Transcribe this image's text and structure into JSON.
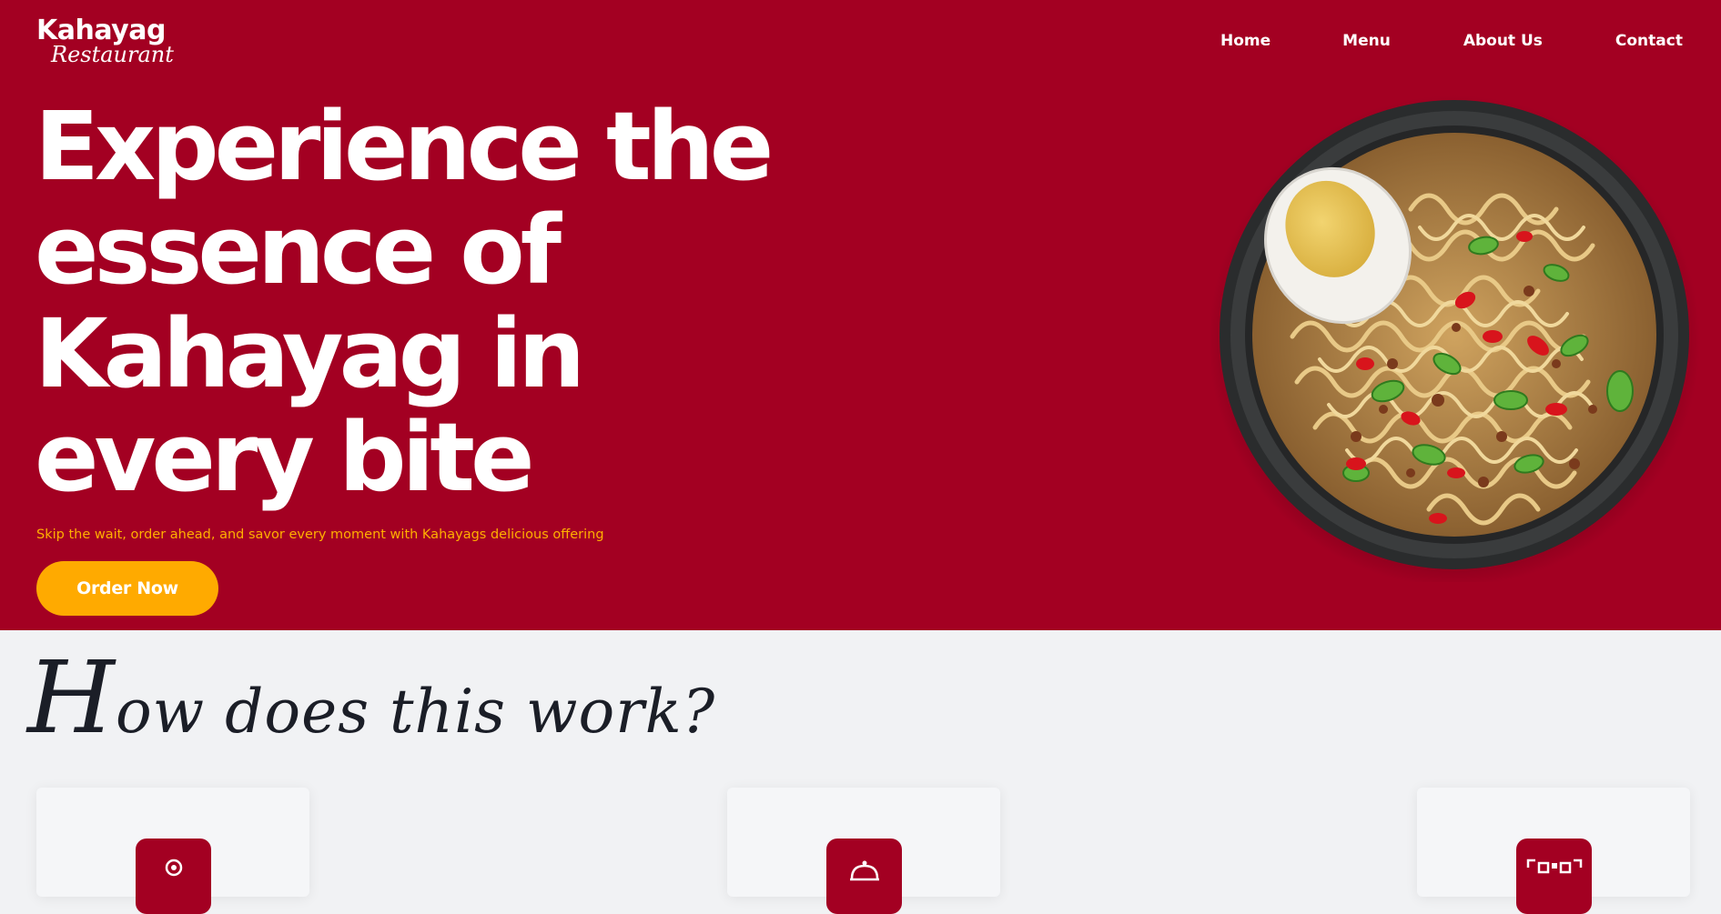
{
  "brand": {
    "name": "Kahayag",
    "tagline": "Restaurant"
  },
  "nav": {
    "items": [
      {
        "label": "Home"
      },
      {
        "label": "Menu"
      },
      {
        "label": "About Us"
      },
      {
        "label": "Contact"
      }
    ]
  },
  "hero": {
    "headline_lines": [
      "Experience the",
      "essence of",
      "Kahayag in",
      "every bite"
    ],
    "subtitle": "Skip the wait, order ahead, and savor every moment with Kahayags delicious offering",
    "cta_label": "Order Now",
    "image": "noodle-bowl-with-egg"
  },
  "how_it_works": {
    "title_initial": "H",
    "title_rest": "ow does this work?",
    "steps": [
      {
        "icon": "location-pin-icon"
      },
      {
        "icon": "cloche-icon"
      },
      {
        "icon": "qr-code-icon"
      }
    ]
  },
  "colors": {
    "brand_red": "#a30022",
    "accent_orange": "#ffaa00",
    "background_light": "#f1f2f4",
    "title_dark": "#1b1e27"
  }
}
